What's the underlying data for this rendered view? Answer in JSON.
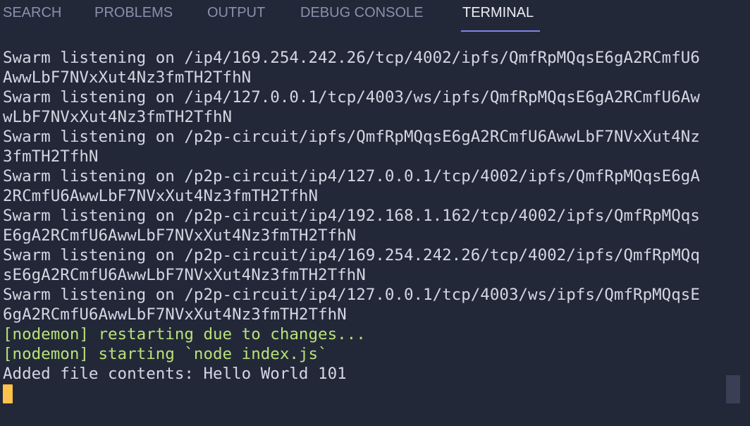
{
  "tabs": [
    {
      "label": "SEARCH",
      "active": false
    },
    {
      "label": "PROBLEMS",
      "active": false
    },
    {
      "label": "OUTPUT",
      "active": false
    },
    {
      "label": "DEBUG CONSOLE",
      "active": false
    },
    {
      "label": "TERMINAL",
      "active": true
    }
  ],
  "terminal": {
    "lines": [
      "Swarm listening on /ip4/169.254.242.26/tcp/4002/ipfs/QmfRpMQqsE6gA2RCmfU6",
      "AwwLbF7NVxXut4Nz3fmTH2TfhN",
      "Swarm listening on /ip4/127.0.0.1/tcp/4003/ws/ipfs/QmfRpMQqsE6gA2RCmfU6Aw",
      "wLbF7NVxXut4Nz3fmTH2TfhN",
      "Swarm listening on /p2p-circuit/ipfs/QmfRpMQqsE6gA2RCmfU6AwwLbF7NVxXut4Nz",
      "3fmTH2TfhN",
      "Swarm listening on /p2p-circuit/ip4/127.0.0.1/tcp/4002/ipfs/QmfRpMQqsE6gA",
      "2RCmfU6AwwLbF7NVxXut4Nz3fmTH2TfhN",
      "Swarm listening on /p2p-circuit/ip4/192.168.1.162/tcp/4002/ipfs/QmfRpMQqs",
      "E6gA2RCmfU6AwwLbF7NVxXut4Nz3fmTH2TfhN",
      "Swarm listening on /p2p-circuit/ip4/169.254.242.26/tcp/4002/ipfs/QmfRpMQq",
      "sE6gA2RCmfU6AwwLbF7NVxXut4Nz3fmTH2TfhN",
      "Swarm listening on /p2p-circuit/ip4/127.0.0.1/tcp/4003/ws/ipfs/QmfRpMQqsE",
      "6gA2RCmfU6AwwLbF7NVxXut4Nz3fmTH2TfhN",
      "[nodemon] restarting due to changes...",
      "[nodemon] starting `node index.js`",
      "Added file contents: Hello World 101"
    ]
  },
  "colors": {
    "background": "#232838",
    "text": "#d4d7e2",
    "nodemon_green": "#b8e27a",
    "cursor": "#ffc24a",
    "tab_inactive": "#8a90ae",
    "tab_active": "#eceef6",
    "tab_underline": "#7f86e8"
  },
  "icons": {
    "cursor": "terminal-cursor-block"
  }
}
